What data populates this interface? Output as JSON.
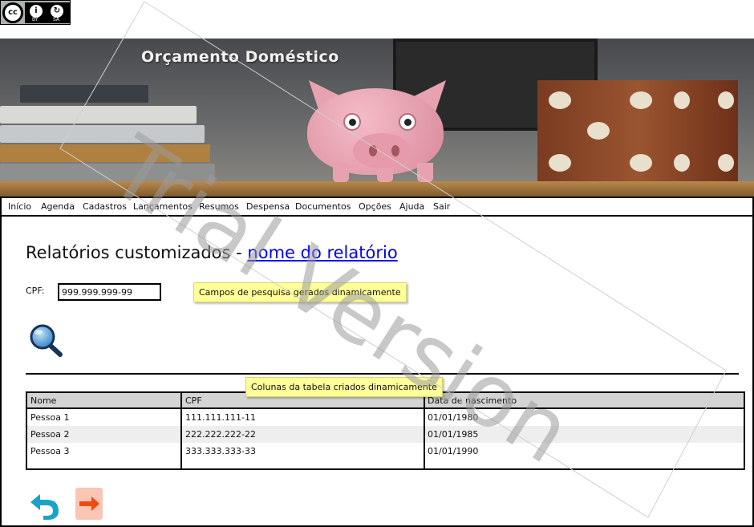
{
  "badge": {
    "cc": "cc",
    "by": "BY",
    "sa": "SA"
  },
  "header": {
    "title": "Orçamento Doméstico"
  },
  "menu": [
    "Início",
    "Agenda",
    "Cadastros",
    "Lançamentos",
    "Resumos",
    "Despensa",
    "Documentos",
    "Opções",
    "Ajuda",
    "Sair"
  ],
  "page": {
    "title_prefix": "Relatórios customizados - ",
    "title_link": "nome do relatório"
  },
  "search": {
    "cpf_label": "CPF:",
    "cpf_value": "999.999.999-99"
  },
  "notes": {
    "fields": "Campos de pesquisa gerados dinamicamente",
    "columns": "Colunas da tabela criados dinamicamente"
  },
  "table": {
    "headers": [
      "Nome",
      "CPF",
      "Data de nascimento"
    ],
    "rows": [
      [
        "Pessoa 1",
        "111.111.111-11",
        "01/01/1980"
      ],
      [
        "Pessoa 2",
        "222.222.222-22",
        "01/01/1985"
      ],
      [
        "Pessoa 3",
        "333.333.333-33",
        "01/01/1990"
      ]
    ]
  },
  "watermark": "Trial Version",
  "icons": {
    "search": "magnifier-icon",
    "back": "back-arrow-icon",
    "exit": "exit-arrow-icon"
  },
  "colors": {
    "link": "#0000ee",
    "note": "#ffff99",
    "back_icon": "#1aa3c8",
    "exit_icon": "#ee4a12"
  }
}
